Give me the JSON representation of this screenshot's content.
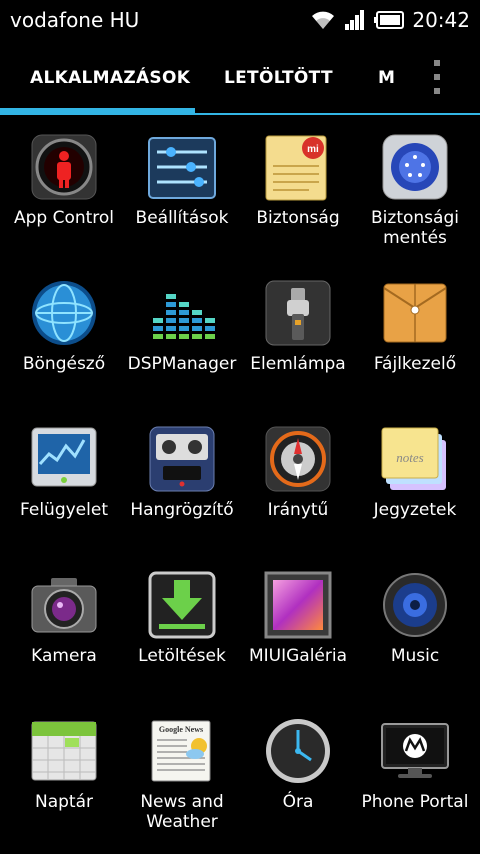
{
  "status": {
    "carrier": "vodafone HU",
    "time": "20:42"
  },
  "tabs": [
    "ALKALMAZÁSOK",
    "LETÖLTÖTT",
    "M"
  ],
  "apps": [
    {
      "label": "App Control",
      "icon": "app-control-icon"
    },
    {
      "label": "Beállítások",
      "icon": "settings-icon"
    },
    {
      "label": "Biztonság",
      "icon": "security-icon"
    },
    {
      "label": "Biztonsági mentés",
      "icon": "backup-icon"
    },
    {
      "label": "Böngésző",
      "icon": "browser-icon"
    },
    {
      "label": "DSPManager",
      "icon": "equalizer-icon"
    },
    {
      "label": "Elemlámpa",
      "icon": "flashlight-icon"
    },
    {
      "label": "Fájlkezelő",
      "icon": "file-manager-icon"
    },
    {
      "label": "Felügyelet",
      "icon": "monitor-icon"
    },
    {
      "label": "Hangrögzítő",
      "icon": "cassette-recorder-icon"
    },
    {
      "label": "Iránytű",
      "icon": "compass-icon"
    },
    {
      "label": "Jegyzetek",
      "icon": "notes-icon"
    },
    {
      "label": "Kamera",
      "icon": "camera-icon"
    },
    {
      "label": "Letöltések",
      "icon": "download-icon"
    },
    {
      "label": "MIUIGaléria",
      "icon": "gallery-icon"
    },
    {
      "label": "Music",
      "icon": "speaker-icon"
    },
    {
      "label": "Naptár",
      "icon": "calendar-icon"
    },
    {
      "label": "News and Weather",
      "icon": "news-weather-icon"
    },
    {
      "label": "Óra",
      "icon": "clock-icon"
    },
    {
      "label": "Phone Portal",
      "icon": "phone-portal-icon"
    }
  ],
  "icon_text": {
    "notes": "notes",
    "news": "Google News"
  }
}
